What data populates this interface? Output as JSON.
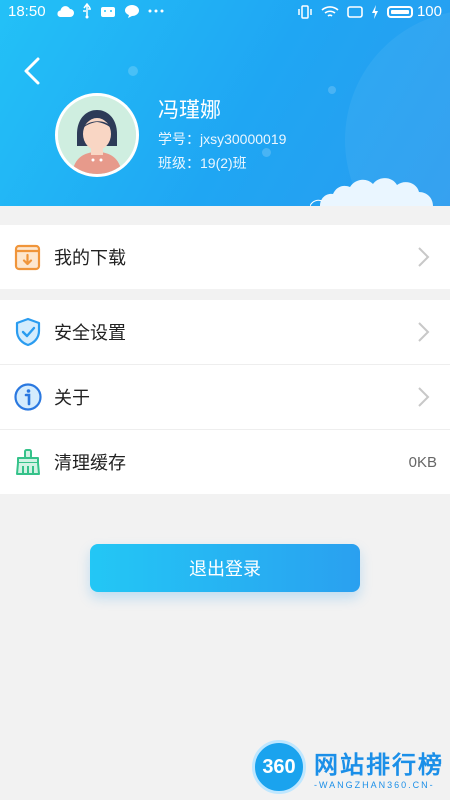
{
  "status_bar": {
    "time": "18:50",
    "battery": "100",
    "icons_left": [
      "cloud-icon",
      "usb-icon",
      "android-icon",
      "message-icon",
      "more-icon"
    ],
    "icons_right": [
      "vibrate-icon",
      "wifi-icon",
      "screen-icon",
      "charging-icon",
      "battery-icon"
    ]
  },
  "profile": {
    "name": "冯瑾娜",
    "student_id": "学号：jxsy30000019",
    "class": "班级：19(2)班"
  },
  "menu_group_1": [
    {
      "label": "我的下载",
      "icon": "download-book-icon"
    }
  ],
  "menu_group_2": [
    {
      "label": "安全设置",
      "icon": "shield-check-icon"
    },
    {
      "label": "关于",
      "icon": "info-icon"
    },
    {
      "label": "清理缓存",
      "icon": "broom-icon",
      "value": "0KB"
    }
  ],
  "logout_label": "退出登录",
  "watermark": {
    "logo": "360",
    "cn": "网站排行榜",
    "en": "-WANGZHAN360.CN-"
  },
  "colors": {
    "header_start": "#23c1f7",
    "header_end": "#2a9cf0",
    "button": "#26b0f2",
    "icon_orange": "#f0953a",
    "icon_blue": "#2a9cf0",
    "icon_green": "#35c28a"
  }
}
